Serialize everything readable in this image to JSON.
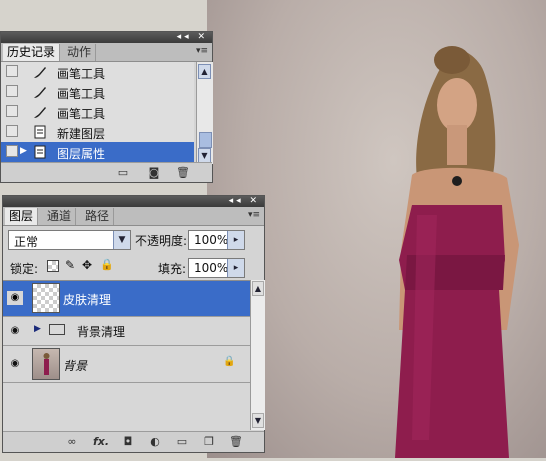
{
  "history_panel": {
    "tabs": [
      {
        "label": "历史记录"
      },
      {
        "label": "动作"
      }
    ],
    "items": [
      {
        "label": "画笔工具",
        "icon": "brush-icon"
      },
      {
        "label": "画笔工具",
        "icon": "brush-icon"
      },
      {
        "label": "画笔工具",
        "icon": "brush-icon"
      },
      {
        "label": "新建图层",
        "icon": "document-icon"
      },
      {
        "label": "图层属性",
        "icon": "document-icon",
        "selected": true
      }
    ],
    "footer_icons": [
      "new-document-from-state-icon",
      "snapshot-icon",
      "trash-icon"
    ]
  },
  "layers_panel": {
    "tabs": [
      {
        "label": "图层"
      },
      {
        "label": "通道"
      },
      {
        "label": "路径"
      }
    ],
    "blend_mode": "正常",
    "opacity_label": "不透明度:",
    "opacity_value": "100%",
    "lock_label": "锁定:",
    "fill_label": "填充:",
    "fill_value": "100%",
    "layers": [
      {
        "name": "皮肤清理",
        "selected": true,
        "thumb": "transparent"
      },
      {
        "name": "背景清理",
        "group": true
      },
      {
        "name": "背景",
        "locked": true,
        "thumb": "photo"
      }
    ],
    "footer_icons": [
      "link-icon",
      "fx-icon",
      "mask-icon",
      "adjustment-icon",
      "folder-icon",
      "new-layer-icon",
      "trash-icon"
    ]
  },
  "colors": {
    "selection": "#3a6cc8",
    "dress": "#8e1d4d",
    "panel": "#d4d4d4"
  }
}
